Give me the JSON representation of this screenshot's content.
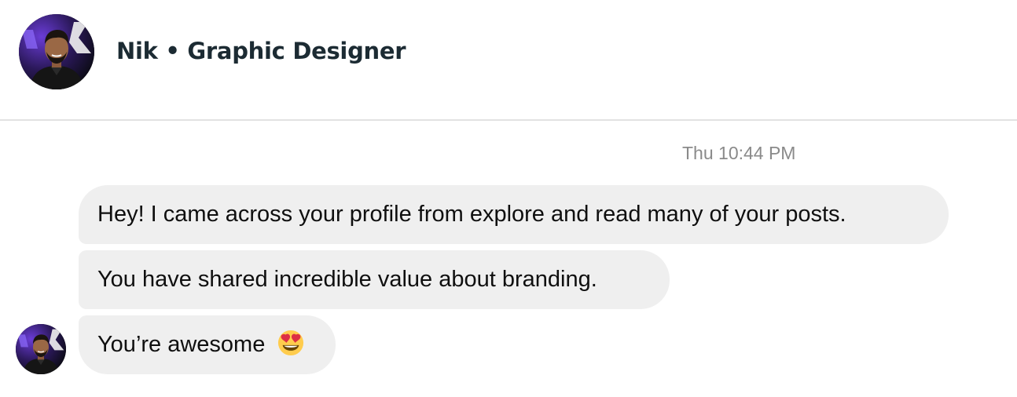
{
  "header": {
    "title": "Nik • Graphic Designer",
    "avatar_icon": "profile-photo"
  },
  "thread": {
    "timestamp": "Thu 10:44 PM",
    "messages": [
      {
        "text": "Hey! I came across your profile from explore and read many of your posts."
      },
      {
        "text": "You have shared incredible value about branding."
      },
      {
        "text": "You’re awesome",
        "emoji": "heart-eyes-emoji"
      }
    ]
  },
  "colors": {
    "bubble_bg": "#efefef",
    "title_text": "#1c2b33",
    "timestamp_text": "#8a8a8a",
    "divider": "#e2e2e2"
  }
}
